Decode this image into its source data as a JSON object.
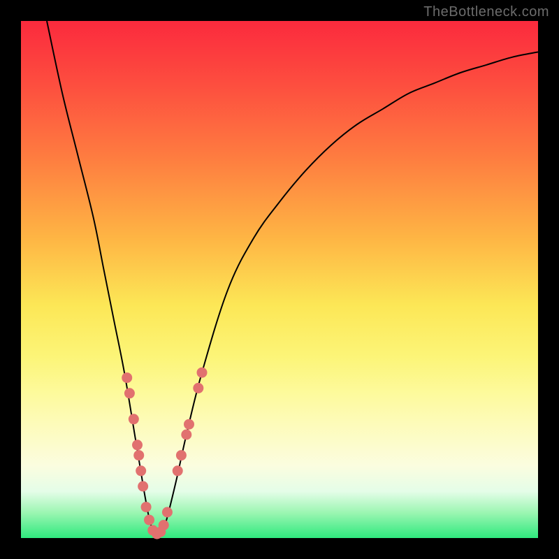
{
  "watermark": "TheBottleneck.com",
  "colors": {
    "background": "#000000",
    "curve": "#000000",
    "marker": "#e1716f",
    "gradient_top": "#fb2a3d",
    "gradient_bottom": "#2fe97e"
  },
  "chart_data": {
    "type": "line",
    "title": "",
    "xlabel": "",
    "ylabel": "",
    "xlim": [
      0,
      100
    ],
    "ylim": [
      0,
      100
    ],
    "grid": false,
    "legend": false,
    "series": [
      {
        "name": "bottleneck-curve",
        "x": [
          5,
          8,
          11,
          14,
          16,
          18,
          20,
          22,
          23,
          24,
          25,
          26,
          27,
          28,
          30,
          32,
          35,
          40,
          45,
          50,
          55,
          60,
          65,
          70,
          75,
          80,
          85,
          90,
          95,
          100
        ],
        "y": [
          100,
          86,
          74,
          62,
          52,
          42,
          32,
          20,
          14,
          8,
          3,
          1,
          1,
          3,
          11,
          20,
          32,
          48,
          58,
          65,
          71,
          76,
          80,
          83,
          86,
          88,
          90,
          91.5,
          93,
          94
        ]
      }
    ],
    "markers": {
      "name": "highlighted-points",
      "points": [
        {
          "x": 20.5,
          "y": 31
        },
        {
          "x": 21.0,
          "y": 28
        },
        {
          "x": 21.8,
          "y": 23
        },
        {
          "x": 22.5,
          "y": 18
        },
        {
          "x": 22.8,
          "y": 16
        },
        {
          "x": 23.2,
          "y": 13
        },
        {
          "x": 23.6,
          "y": 10
        },
        {
          "x": 24.2,
          "y": 6
        },
        {
          "x": 24.8,
          "y": 3.5
        },
        {
          "x": 25.5,
          "y": 1.5
        },
        {
          "x": 26.3,
          "y": 0.8
        },
        {
          "x": 27.0,
          "y": 1.2
        },
        {
          "x": 27.6,
          "y": 2.5
        },
        {
          "x": 28.3,
          "y": 5
        },
        {
          "x": 30.3,
          "y": 13
        },
        {
          "x": 31.0,
          "y": 16
        },
        {
          "x": 32.0,
          "y": 20
        },
        {
          "x": 32.5,
          "y": 22
        },
        {
          "x": 34.3,
          "y": 29
        },
        {
          "x": 35.0,
          "y": 32
        }
      ]
    }
  }
}
